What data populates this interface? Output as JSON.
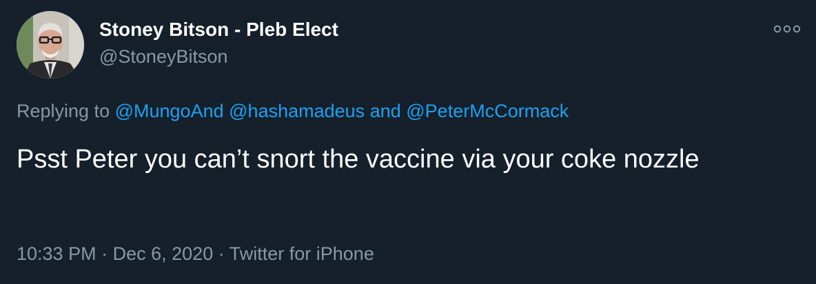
{
  "author": {
    "display_name": "Stoney Bitson - Pleb Elect",
    "handle": "@StoneyBitson",
    "avatar_icon": "avatar-photo"
  },
  "more_icon": "more-options-icon",
  "reply": {
    "prefix": "Replying to",
    "mentions": [
      "@MungoAnd",
      "@hashamadeus",
      "@PeterMcCormack"
    ],
    "conjunction": "and"
  },
  "text": "Psst Peter you can’t snort the vaccine via your coke nozzle",
  "meta": {
    "time": "10:33 PM",
    "separator": "·",
    "date": "Dec 6, 2020",
    "source": "Twitter for iPhone"
  },
  "colors": {
    "background": "#15202b",
    "primary_text": "#ffffff",
    "secondary_text": "#8899a6",
    "link": "#1da1f2"
  }
}
